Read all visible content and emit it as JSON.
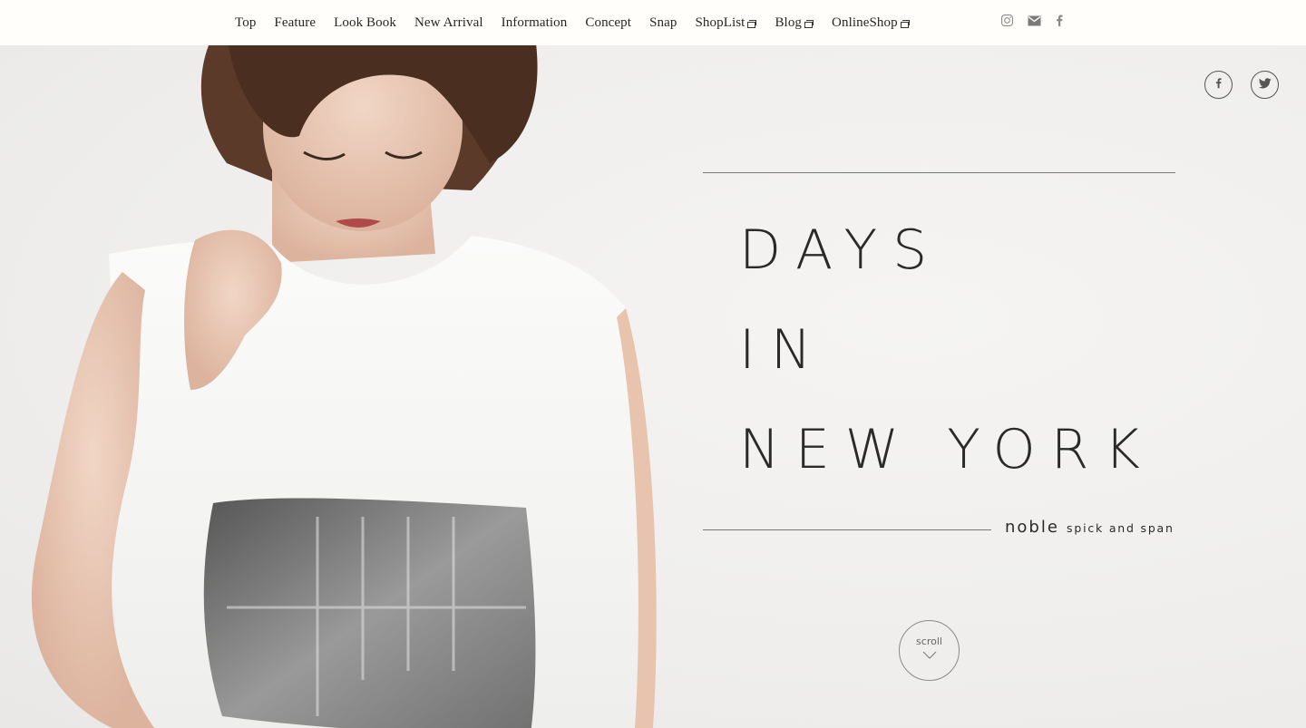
{
  "nav": {
    "items": [
      {
        "label": "Top",
        "external": false
      },
      {
        "label": "Feature",
        "external": false
      },
      {
        "label": "Look Book",
        "external": false
      },
      {
        "label": "New Arrival",
        "external": false
      },
      {
        "label": "Information",
        "external": false
      },
      {
        "label": "Concept",
        "external": false
      },
      {
        "label": "Snap",
        "external": false
      },
      {
        "label": "ShopList",
        "external": true
      },
      {
        "label": "Blog",
        "external": true
      },
      {
        "label": "OnlineShop",
        "external": true
      }
    ]
  },
  "header_social": {
    "icons": [
      "instagram-icon",
      "mail-icon",
      "facebook-icon"
    ]
  },
  "share": {
    "icons": [
      "facebook-icon",
      "twitter-icon"
    ]
  },
  "hero": {
    "line1": "DAYS",
    "line2": "IN",
    "line3": "NEW YORK",
    "brand_name": "noble",
    "brand_sub": "spick and span",
    "scroll_label": "scroll"
  },
  "colors": {
    "header_bg": "#fffefb",
    "text": "#2a2a2a",
    "background": "#f2f1ef"
  }
}
